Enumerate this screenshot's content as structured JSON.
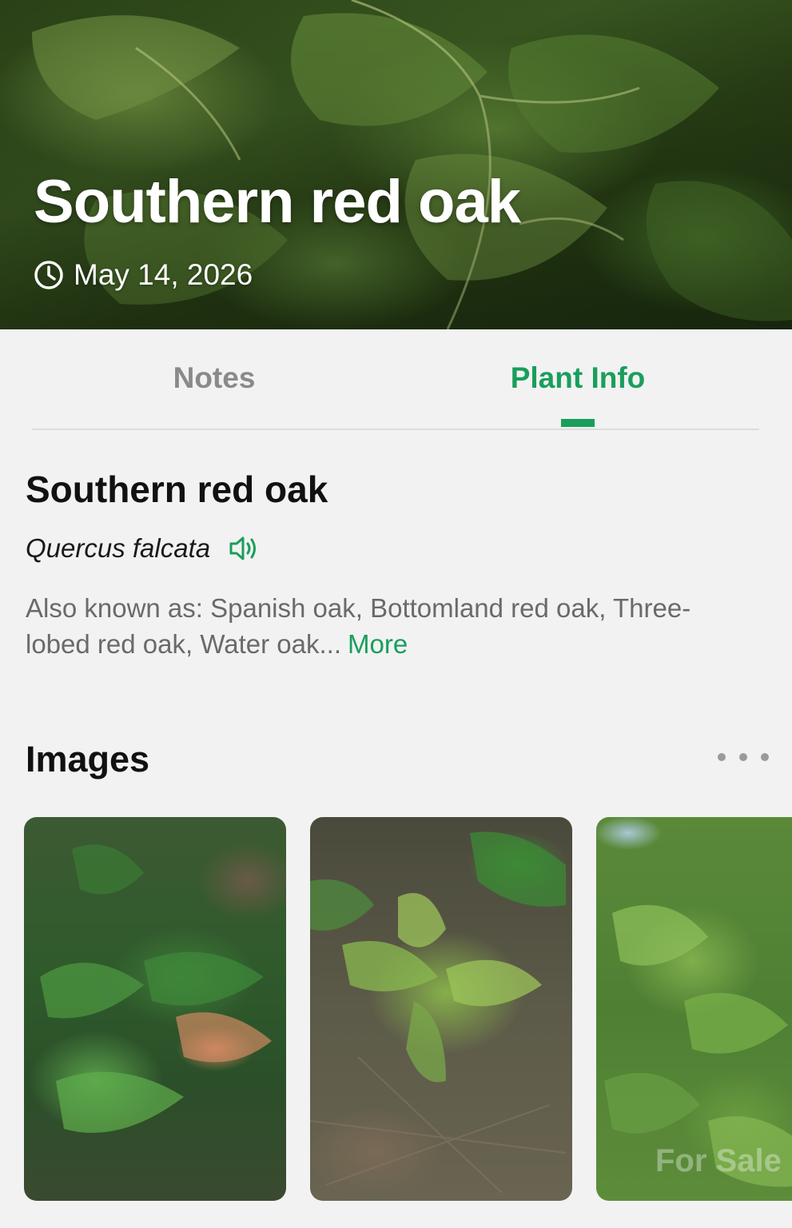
{
  "hero": {
    "title": "Southern red oak",
    "date": "May 14, 2026"
  },
  "tabs": [
    {
      "label": "Notes",
      "active": false
    },
    {
      "label": "Plant Info",
      "active": true
    }
  ],
  "plant": {
    "common_name": "Southern red oak",
    "scientific_name": "Quercus falcata",
    "also_known_as": "Also known as: Spanish oak, Bottomland red oak, Three-lobed red oak, Water oak...",
    "more_label": "More"
  },
  "images_section": {
    "heading": "Images",
    "thumbnails": [
      {
        "alt": "oak sapling with reddish new leaves"
      },
      {
        "alt": "young oak seedling on forest floor"
      },
      {
        "alt": "oak foliage in sunlight"
      }
    ]
  },
  "watermark": "For Sale",
  "colors": {
    "accent": "#1a9e5c",
    "background": "#f2f2f2",
    "inactive_tab": "#8a8a8a",
    "secondary_text": "#6a6a6a"
  },
  "icons": {
    "date": "clock-icon",
    "pronounce": "speaker-icon",
    "images_menu": "more-horizontal-icon"
  }
}
